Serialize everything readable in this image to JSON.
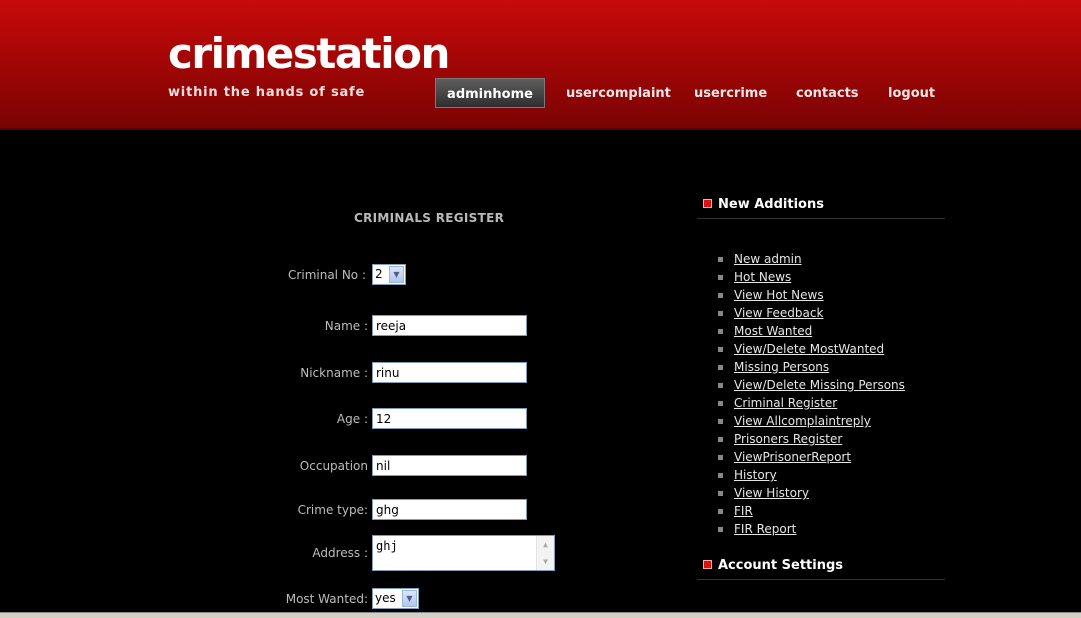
{
  "header": {
    "logo": "crimestation",
    "tagline": "within the hands of safe",
    "nav": [
      "adminhome",
      "usercomplaint",
      "usercrime",
      "contacts",
      "logout"
    ]
  },
  "form": {
    "title": "CRIMINALS REGISTER",
    "criminal_no": {
      "label": "Criminal No :",
      "value": "2"
    },
    "name": {
      "label": "Name :",
      "value": "reeja"
    },
    "nickname": {
      "label": "Nickname :",
      "value": "rinu"
    },
    "age": {
      "label": "Age :",
      "value": "12"
    },
    "occupation": {
      "label": "Occupation",
      "value": "nil"
    },
    "crime_type": {
      "label": "Crime type:",
      "value": "ghg"
    },
    "address": {
      "label": "Address :",
      "value": "ghj"
    },
    "most_wanted": {
      "label": "Most Wanted:",
      "value": "yes"
    }
  },
  "sidebar": {
    "new_additions": "New Additions",
    "links": [
      "New admin",
      "Hot News",
      "View Hot News",
      "View Feedback",
      "Most Wanted",
      "View/Delete MostWanted",
      "Missing Persons",
      "View/Delete Missing Persons",
      "Criminal Register",
      "View Allcomplaintreply",
      "Prisoners Register",
      "ViewPrisonerReport",
      "History",
      "View History",
      "FIR",
      "FIR Report"
    ],
    "account_settings": "Account Settings"
  },
  "colors": {
    "header_red": "#b30606",
    "background": "#000000"
  }
}
